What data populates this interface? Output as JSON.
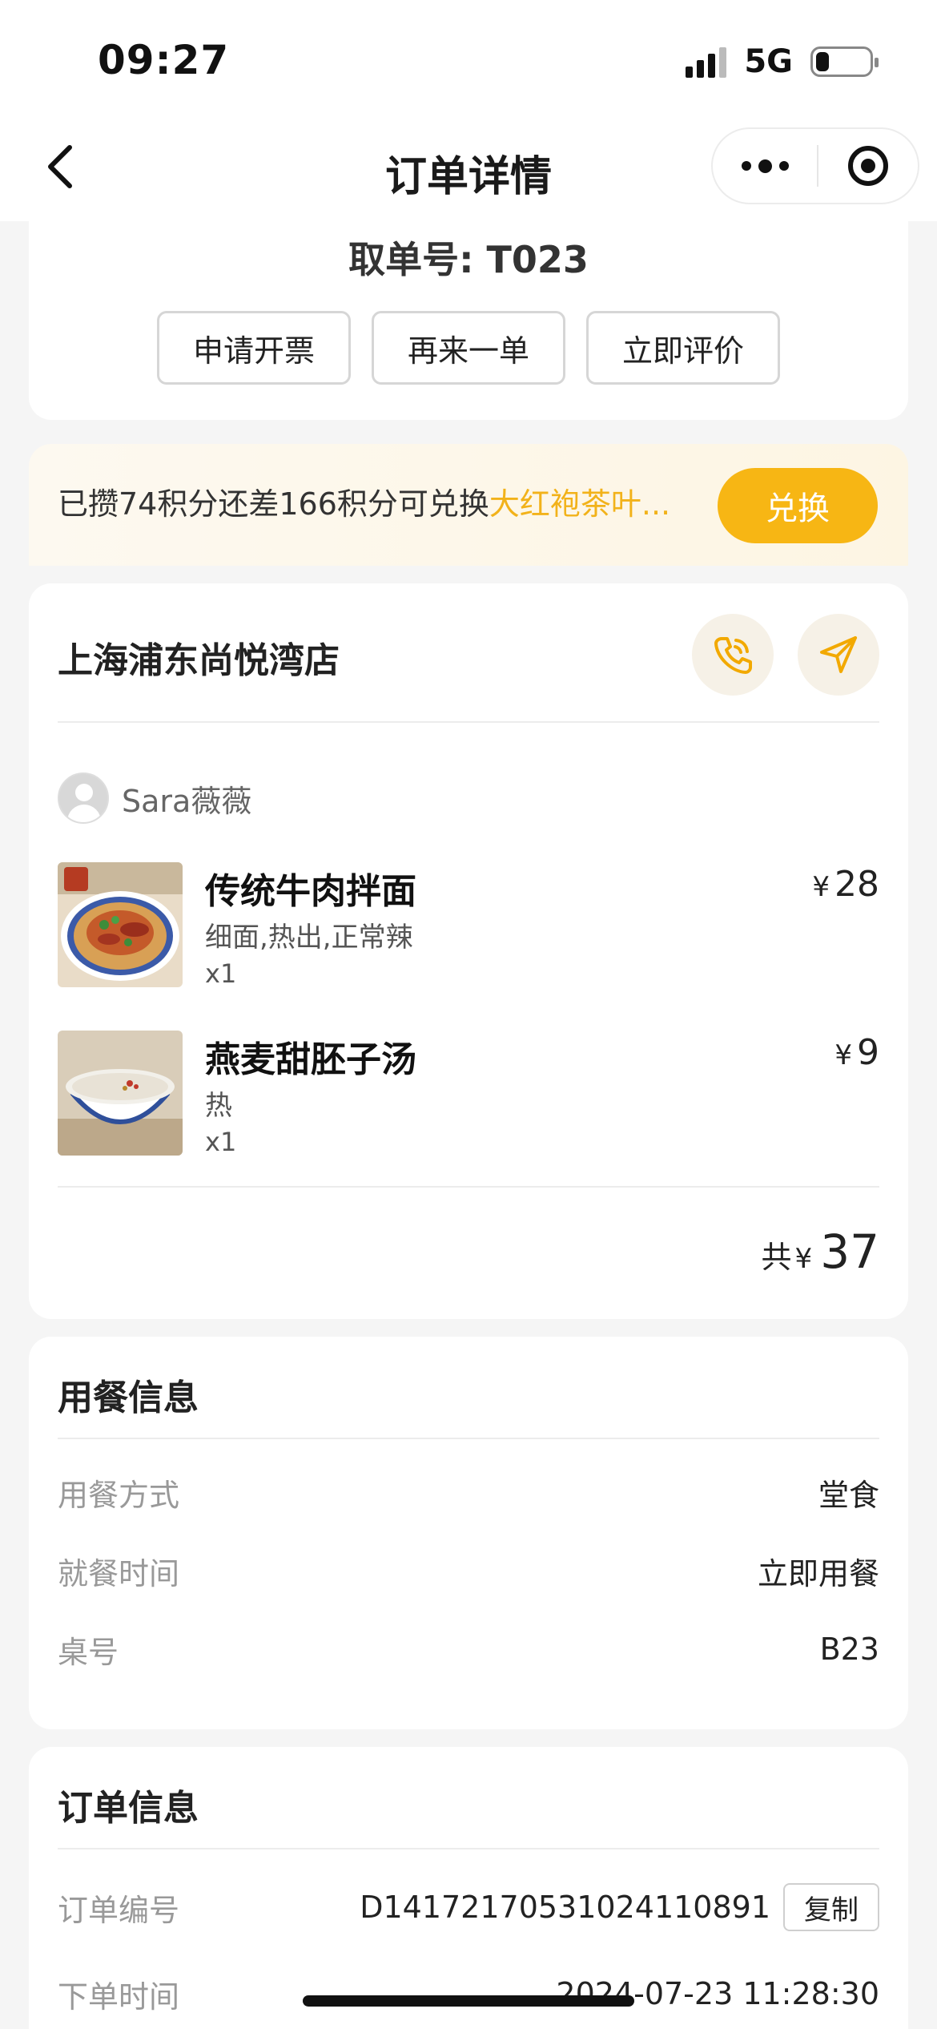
{
  "status_bar": {
    "time": "09:27",
    "network": "5G"
  },
  "nav": {
    "title": "订单详情"
  },
  "order_header": {
    "pickup_number": "取单号: T023",
    "actions": [
      "申请开票",
      "再来一单",
      "立即评价"
    ]
  },
  "points_banner": {
    "prefix": "已攒74积分还差166积分可兑换",
    "highlight": "大红袍茶叶...",
    "button": "兑换"
  },
  "store": {
    "name": "上海浦东尚悦湾店",
    "user": "Sara薇薇",
    "items": [
      {
        "name": "传统牛肉拌面",
        "spec": "细面,热出,正常辣",
        "qty": "x1",
        "currency": "¥",
        "price": "28"
      },
      {
        "name": "燕麦甜胚子汤",
        "spec": "热",
        "qty": "x1",
        "currency": "¥",
        "price": "9"
      }
    ],
    "total": {
      "label": "共",
      "currency": "¥",
      "amount": "37"
    }
  },
  "dining_info": {
    "title": "用餐信息",
    "rows": [
      {
        "key": "用餐方式",
        "value": "堂食"
      },
      {
        "key": "就餐时间",
        "value": "立即用餐"
      },
      {
        "key": "桌号",
        "value": "B23"
      }
    ]
  },
  "order_info": {
    "title": "订单信息",
    "rows": [
      {
        "key": "订单编号",
        "value": "D14172170531024110891",
        "action": "复制"
      },
      {
        "key": "下单时间",
        "value": "2024-07-23 11:28:30"
      }
    ]
  },
  "colors": {
    "accent": "#f7b614",
    "highlight_text": "#f2b21a",
    "background": "#f5f5f5"
  }
}
